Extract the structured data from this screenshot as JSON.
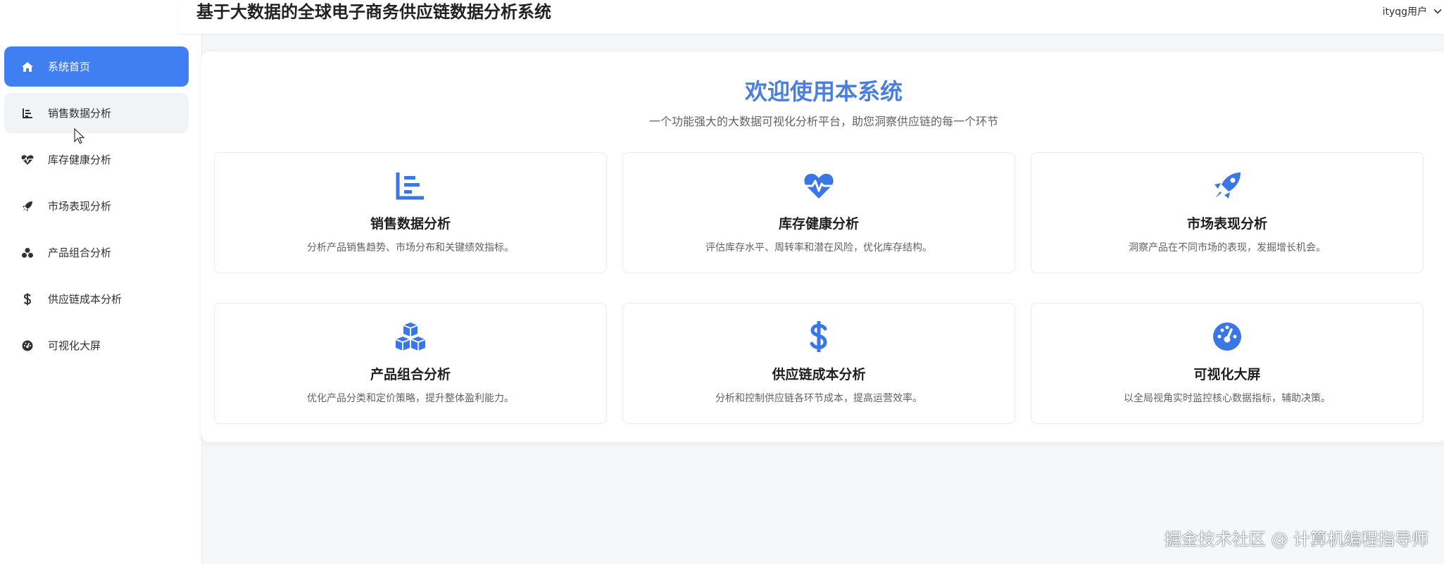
{
  "header": {
    "title": "基于大数据的全球电子商务供应链数据分析系统",
    "user": "ityqg用户"
  },
  "sidebar": {
    "items": [
      {
        "label": "系统首页",
        "icon": "home-icon"
      },
      {
        "label": "销售数据分析",
        "icon": "chart-icon"
      },
      {
        "label": "库存健康分析",
        "icon": "heartbeat-icon"
      },
      {
        "label": "市场表现分析",
        "icon": "rocket-icon"
      },
      {
        "label": "产品组合分析",
        "icon": "cubes-icon"
      },
      {
        "label": "供应链成本分析",
        "icon": "dollar-icon"
      },
      {
        "label": "可视化大屏",
        "icon": "gauge-icon"
      }
    ]
  },
  "main": {
    "welcome_title": "欢迎使用本系统",
    "welcome_subtitle": "一个功能强大的大数据可视化分析平台，助您洞察供应链的每一个环节",
    "features": [
      {
        "title": "销售数据分析",
        "desc": "分析产品销售趋势、市场分布和关键绩效指标。",
        "icon": "chart-icon"
      },
      {
        "title": "库存健康分析",
        "desc": "评估库存水平、周转率和潜在风险，优化库存结构。",
        "icon": "heartbeat-icon"
      },
      {
        "title": "市场表现分析",
        "desc": "洞察产品在不同市场的表现，发掘增长机会。",
        "icon": "rocket-icon"
      },
      {
        "title": "产品组合分析",
        "desc": "优化产品分类和定价策略，提升整体盈利能力。",
        "icon": "cubes-icon"
      },
      {
        "title": "供应链成本分析",
        "desc": "分析和控制供应链各环节成本，提高运营效率。",
        "icon": "dollar-icon"
      },
      {
        "title": "可视化大屏",
        "desc": "以全局视角实时监控核心数据指标，辅助决策。",
        "icon": "gauge-icon"
      }
    ]
  },
  "watermark": "掘金技术社区 @ 计算机编程指导师",
  "colors": {
    "accent": "#3f7ff2",
    "title_blue": "#4a7fdb",
    "icon_blue": "#3a76e6"
  }
}
